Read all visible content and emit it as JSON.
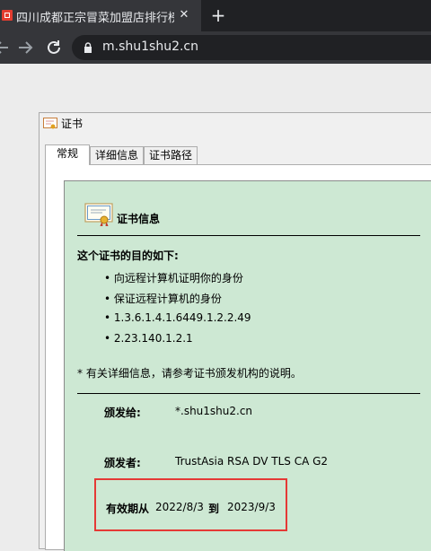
{
  "browser": {
    "tab_title": "四川成都正宗冒菜加盟店排行榜(",
    "url": "m.shu1shu2.cn"
  },
  "dialog": {
    "title": "证书",
    "tabs": [
      "常规",
      "详细信息",
      "证书路径"
    ],
    "cert_info_title": "证书信息",
    "purpose_heading": "这个证书的目的如下:",
    "purposes": [
      "• 向远程计算机证明你的身份",
      "• 保证远程计算机的身份",
      "• 1.3.6.1.4.1.6449.1.2.2.49",
      "• 2.23.140.1.2.1"
    ],
    "note": "* 有关详细信息，请参考证书颁发机构的说明。",
    "issued_to_label": "颁发给:",
    "issued_to": "*.shu1shu2.cn",
    "issued_by_label": "颁发者:",
    "issued_by": "TrustAsia RSA DV TLS CA G2",
    "valid_from_label": "有效期从",
    "valid_from": "2022/8/3",
    "to_label": "到",
    "valid_to": "2023/9/3"
  }
}
